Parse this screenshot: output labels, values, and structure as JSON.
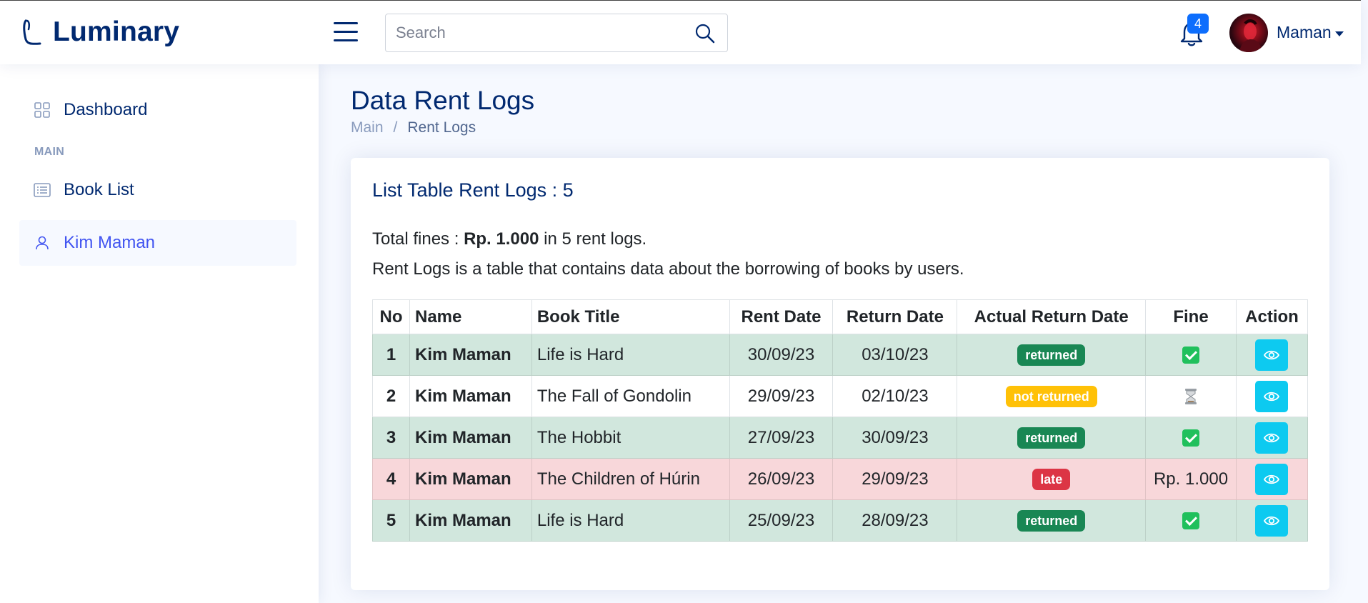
{
  "header": {
    "brand": "Luminary",
    "search_placeholder": "Search",
    "notification_count": "4",
    "user_name": "Maman"
  },
  "sidebar": {
    "items": [
      {
        "label": "Dashboard",
        "icon": "grid-icon"
      },
      {
        "label": "Book List",
        "icon": "list-icon"
      },
      {
        "label": "Kim Maman",
        "icon": "person-icon",
        "active": true
      }
    ],
    "heading_main": "MAIN"
  },
  "page": {
    "title": "Data Rent Logs",
    "breadcrumb": [
      "Main",
      "/",
      "Rent Logs"
    ]
  },
  "card": {
    "title": "List Table Rent Logs : 5",
    "summary_prefix": "Total fines : ",
    "summary_amount": "Rp. 1.000",
    "summary_suffix": " in 5 rent logs.",
    "description": "Rent Logs is a table that contains data about the borrowing of books by users."
  },
  "table": {
    "headers": [
      "No",
      "Name",
      "Book Title",
      "Rent Date",
      "Return Date",
      "Actual Return Date",
      "Fine",
      "Action"
    ],
    "rows": [
      {
        "no": "1",
        "name": "Kim Maman",
        "book": "Life is Hard",
        "rent": "30/09/23",
        "ret": "03/10/23",
        "status": "returned",
        "fine": "",
        "fine_icon": "check-icon"
      },
      {
        "no": "2",
        "name": "Kim Maman",
        "book": "The Fall of Gondolin",
        "rent": "29/09/23",
        "ret": "02/10/23",
        "status": "not returned",
        "fine": "",
        "fine_icon": "hourglass-icon"
      },
      {
        "no": "3",
        "name": "Kim Maman",
        "book": "The Hobbit",
        "rent": "27/09/23",
        "ret": "30/09/23",
        "status": "returned",
        "fine": "",
        "fine_icon": "check-icon"
      },
      {
        "no": "4",
        "name": "Kim Maman",
        "book": "The Children of Húrin",
        "rent": "26/09/23",
        "ret": "29/09/23",
        "status": "late",
        "fine": "Rp. 1.000",
        "fine_icon": ""
      },
      {
        "no": "5",
        "name": "Kim Maman",
        "book": "Life is Hard",
        "rent": "25/09/23",
        "ret": "28/09/23",
        "status": "returned",
        "fine": "",
        "fine_icon": "check-icon"
      }
    ]
  },
  "colors": {
    "primary": "#012970",
    "accent": "#4154f1",
    "returned": "#198754",
    "not_returned": "#ffc107",
    "late": "#dc3545",
    "action": "#0dcaf0"
  }
}
